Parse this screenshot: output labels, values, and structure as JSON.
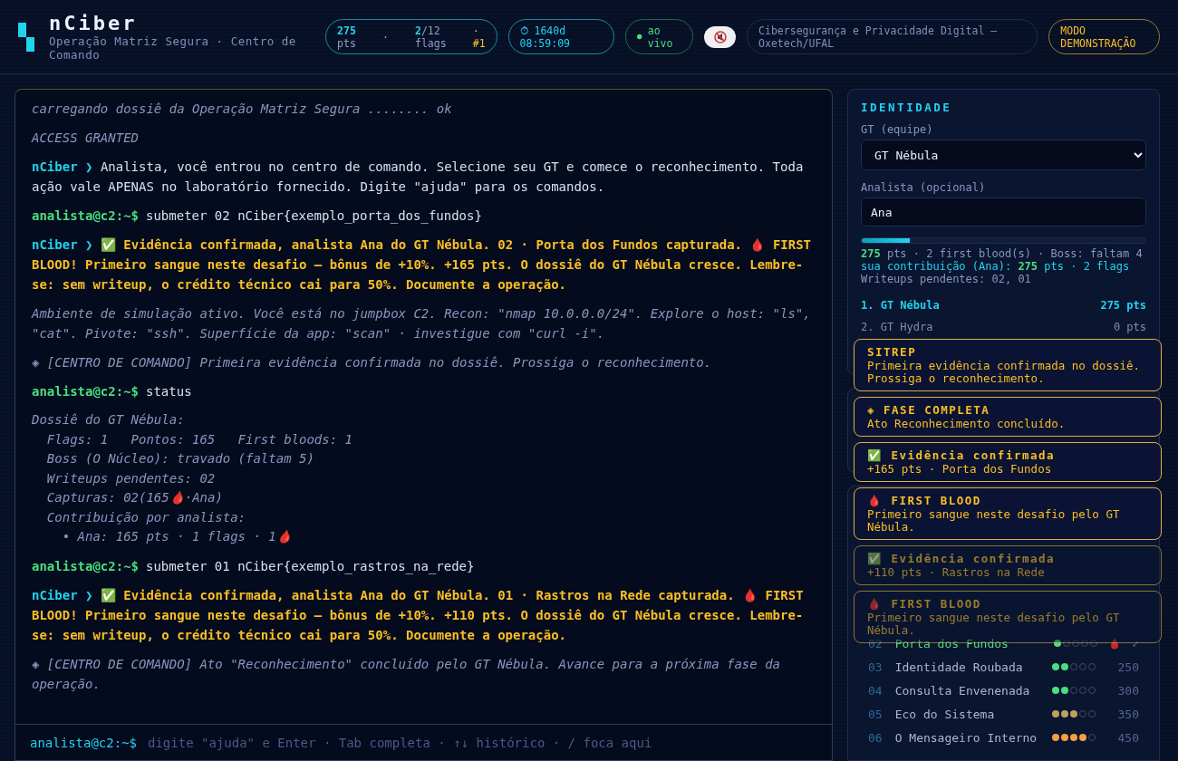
{
  "header": {
    "title": "nCiber",
    "subtitle": "Operação Matriz Segura · Centro de Comando",
    "score": {
      "points": "275",
      "points_unit": "pts",
      "sep1": "·",
      "flags_got": "2",
      "flags_total": "/12",
      "flags_unit": "flags",
      "sep2": "·",
      "rank": "#1"
    },
    "timer": "⏱ 1640d 08:59:09",
    "live": "ao vivo",
    "muted": true,
    "course": "Cibersegurança e Privacidade Digital — Oxetech/UFAL",
    "mode": "MODO DEMONSTRAÇÃO"
  },
  "terminal": {
    "lines": [
      {
        "kind": "sys",
        "text": "carregando dossiê da Operação Matriz Segura ........ ok"
      },
      {
        "kind": "sys",
        "text": "ACCESS GRANTED"
      },
      {
        "kind": "bot",
        "speaker": "nCiber ❯",
        "text": "Analista, você entrou no centro de comando. Selecione seu GT e comece o reconhecimento. Toda ação vale APENAS no laboratório fornecido. Digite \"ajuda\" para os comandos."
      },
      {
        "kind": "cmd",
        "prompt": "analista@c2:~$",
        "text": "submeter 02 nCiber{exemplo_porta_dos_fundos}"
      },
      {
        "kind": "alert",
        "speaker": "nCiber ❯",
        "text": "✅ Evidência confirmada, analista Ana do GT Nébula. 02 · Porta dos Fundos capturada. 🩸 FIRST BLOOD! Primeiro sangue neste desafio — bônus de +10%. +165 pts. O dossiê do GT Nébula cresce. Lembre-se: sem writeup, o crédito técnico cai para 50%. Documente a operação."
      },
      {
        "kind": "sys",
        "text": "Ambiente de simulação ativo. Você está no jumpbox C2. Recon: \"nmap 10.0.0.0/24\". Explore o host: \"ls\", \"cat\". Pivote: \"ssh\". Superfície da app: \"scan\" · investigue com \"curl -i\"."
      },
      {
        "kind": "sys",
        "text": "◈ [CENTRO DE COMANDO] Primeira evidência confirmada no dossiê. Prossiga o reconhecimento."
      },
      {
        "kind": "cmd",
        "prompt": "analista@c2:~$",
        "text": "status"
      },
      {
        "kind": "output",
        "lines": [
          "Dossiê do GT Nébula:",
          "  Flags: 1   Pontos: 165   First bloods: 1",
          "  Boss (O Núcleo): travado (faltam 5)",
          "  Writeups pendentes: 02",
          "  Capturas: 02(165🩸·Ana)",
          "  Contribuição por analista:",
          "    • Ana: 165 pts · 1 flags · 1🩸"
        ]
      },
      {
        "kind": "cmd",
        "prompt": "analista@c2:~$",
        "text": "submeter 01 nCiber{exemplo_rastros_na_rede}"
      },
      {
        "kind": "alert",
        "speaker": "nCiber ❯",
        "text": "✅ Evidência confirmada, analista Ana do GT Nébula. 01 · Rastros na Rede capturada. 🩸 FIRST BLOOD! Primeiro sangue neste desafio — bônus de +10%. +110 pts. O dossiê do GT Nébula cresce. Lembre-se: sem writeup, o crédito técnico cai para 50%. Documente a operação."
      },
      {
        "kind": "sys",
        "text": "◈ [CENTRO DE COMANDO] Ato \"Reconhecimento\" concluído pelo GT Nébula. Avance para a próxima fase da operação."
      }
    ],
    "input": {
      "prompt": "analista@c2:~$",
      "placeholder": "digite \"ajuda\" e Enter · Tab completa · ↑↓ histórico · / foca aqui"
    }
  },
  "identity": {
    "heading": "IDENTIDADE",
    "team_label": "GT (equipe)",
    "team": "GT Nébula",
    "analyst_label": "Analista (opcional)",
    "analyst": "Ana",
    "level": 0.17,
    "stats": [
      "**275** pts · 2 first blood(s) · Boss: faltam 4",
      "sua contribuição (Ana): **275** pts · 2 flags",
      "Writeups pendentes: 02, 01"
    ],
    "ranking": [
      {
        "name": "1. GT Nébula",
        "points": "275 pts",
        "selected": true
      },
      {
        "name": "2. GT Hydra",
        "points": "0 pts",
        "selected": false
      }
    ]
  },
  "challenges": [
    {
      "num": "02",
      "name": "Porta dos Fundos",
      "stars": 1,
      "solved": true,
      "mark": "✓"
    },
    {
      "num": "03",
      "name": "Identidade Roubada",
      "stars": 2,
      "solved": false,
      "points": "250"
    },
    {
      "num": "04",
      "name": "Consulta Envenenada",
      "stars": 2,
      "solved": false,
      "points": "300"
    },
    {
      "num": "05",
      "name": "Eco do Sistema",
      "stars": 3,
      "solved": false,
      "points": "350"
    },
    {
      "num": "06",
      "name": "O Mensageiro Interno",
      "stars": 4,
      "solved": false,
      "points": "450"
    }
  ],
  "toasts": [
    {
      "title": "SITREP",
      "text": "Primeira evidência confirmada no dossiê. Prossiga o reconhecimento.",
      "faded": false
    },
    {
      "title": "◈ FASE COMPLETA",
      "text": "Ato Reconhecimento concluído.",
      "faded": false
    },
    {
      "title": "✅ Evidência confirmada",
      "text": "+165 pts · Porta dos Fundos",
      "faded": false
    },
    {
      "title": "🩸 FIRST BLOOD",
      "text": "Primeiro sangue neste desafio pelo GT Nébula.",
      "faded": false
    },
    {
      "title": "✅ Evidência confirmada",
      "text": "+110 pts · Rastros na Rede",
      "faded": true
    },
    {
      "title": "🩸 FIRST BLOOD",
      "text": "Primeiro sangue neste desafio pelo GT Nébula.",
      "faded": true
    }
  ]
}
